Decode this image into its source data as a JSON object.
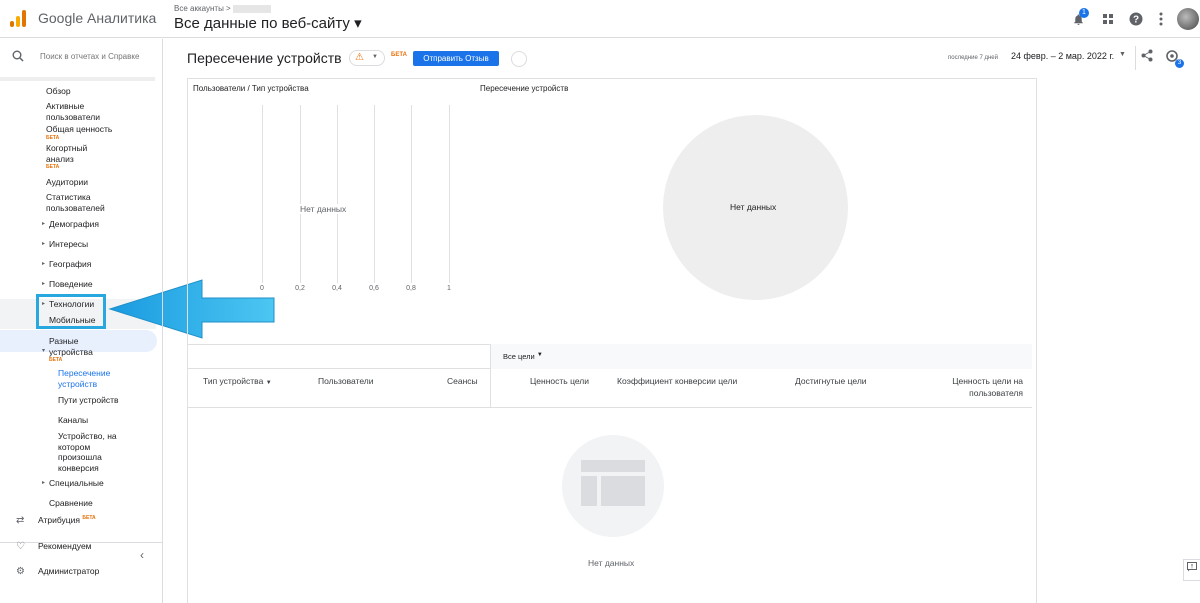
{
  "app": {
    "brand": "Google Аналитика"
  },
  "header": {
    "breadcrumb": "Все аккаунты >",
    "property": "Все данные по веб-сайту ▾",
    "notifications_count": "1"
  },
  "sidebar": {
    "search_placeholder": "Поиск в отчетах и Справке",
    "items": [
      {
        "label": "Обзор"
      },
      {
        "label": "Активные пользователи"
      },
      {
        "label": "Общая ценность",
        "beta": "БЕТА"
      },
      {
        "label": "Когортный анализ",
        "beta": "БЕТА"
      },
      {
        "label": "Аудитории"
      },
      {
        "label": "Статистика пользователей"
      },
      {
        "label": "Демография"
      },
      {
        "label": "Интересы"
      },
      {
        "label": "География"
      },
      {
        "label": "Поведение"
      },
      {
        "label": "Технологии"
      },
      {
        "label": "Мобильные устройства"
      },
      {
        "label": "Разные устройства",
        "beta": "БЕТА"
      },
      {
        "label": "Пересечение устройств"
      },
      {
        "label": "Пути устройств"
      },
      {
        "label": "Каналы"
      },
      {
        "label": "Устройство, на котором произошла конверсия"
      },
      {
        "label": "Специальные"
      },
      {
        "label": "Сравнение"
      }
    ],
    "bottom": [
      {
        "label": "Атрибуция",
        "beta": "БЕТА"
      },
      {
        "label": "Рекомендуем"
      },
      {
        "label": "Администратор"
      }
    ]
  },
  "report": {
    "title": "Пересечение устройств",
    "beta": "БЕТА",
    "feedback_button": "Отправить Отзыв",
    "date_prefix": "последние 7 дней",
    "date_range": "24 февр. – 2 мар. 2022 г.",
    "insights_count": "3"
  },
  "charts": {
    "left_title": "Пользователи / Тип устройства",
    "right_title": "Пересечение устройств",
    "left_nodata": "Нет данных",
    "right_nodata": "Нет данных",
    "ticks": [
      "0",
      "0,2",
      "0,4",
      "0,6",
      "0,8",
      "1"
    ]
  },
  "table": {
    "goals_select": "Все цели",
    "columns": {
      "device_type": "Тип устройства",
      "users": "Пользователи",
      "sessions": "Сеансы",
      "goal_value": "Ценность цели",
      "goal_conv": "Коэффициент конверсии цели",
      "goals_achieved": "Достигнутые цели",
      "goal_value_per_user": "Ценность цели на пользователя"
    },
    "nodata": "Нет данных"
  },
  "colors": {
    "accent": "#1a73e8",
    "beta": "#e8710a",
    "arrow": "#29a8e0"
  }
}
